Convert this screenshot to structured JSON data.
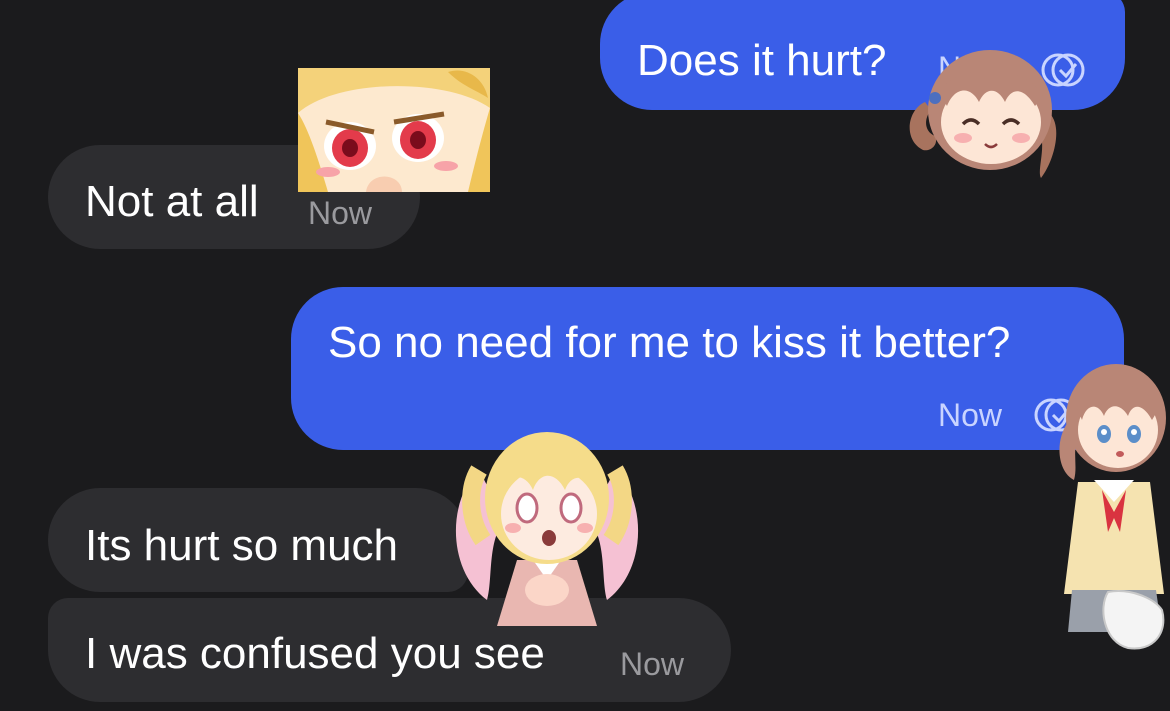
{
  "conversation": {
    "messages": [
      {
        "direction": "outgoing",
        "text": "Does it hurt?",
        "time": "Now"
      },
      {
        "direction": "incoming",
        "text": "Not at all",
        "time": "Now"
      },
      {
        "direction": "outgoing",
        "text": "So no need for me to kiss it better?",
        "time": "Now"
      },
      {
        "direction": "incoming",
        "text": "Its hurt so much",
        "time": ""
      },
      {
        "direction": "incoming",
        "text": "I was confused you see",
        "time": "Now"
      }
    ]
  },
  "icons": {
    "read_receipt": "double-check-circle-icon"
  },
  "stickers": [
    {
      "name": "anime-girl-blonde-smug-sticker"
    },
    {
      "name": "anime-girl-brown-smiling-sticker"
    },
    {
      "name": "anime-girl-blonde-crying-sticker"
    },
    {
      "name": "anime-girl-brown-uniform-sticker"
    }
  ],
  "colors": {
    "background": "#1b1b1d",
    "incoming_bubble": "#2d2d30",
    "outgoing_bubble": "#3a5ee8",
    "text": "#ffffff",
    "timestamp": "#9a9a9e"
  }
}
